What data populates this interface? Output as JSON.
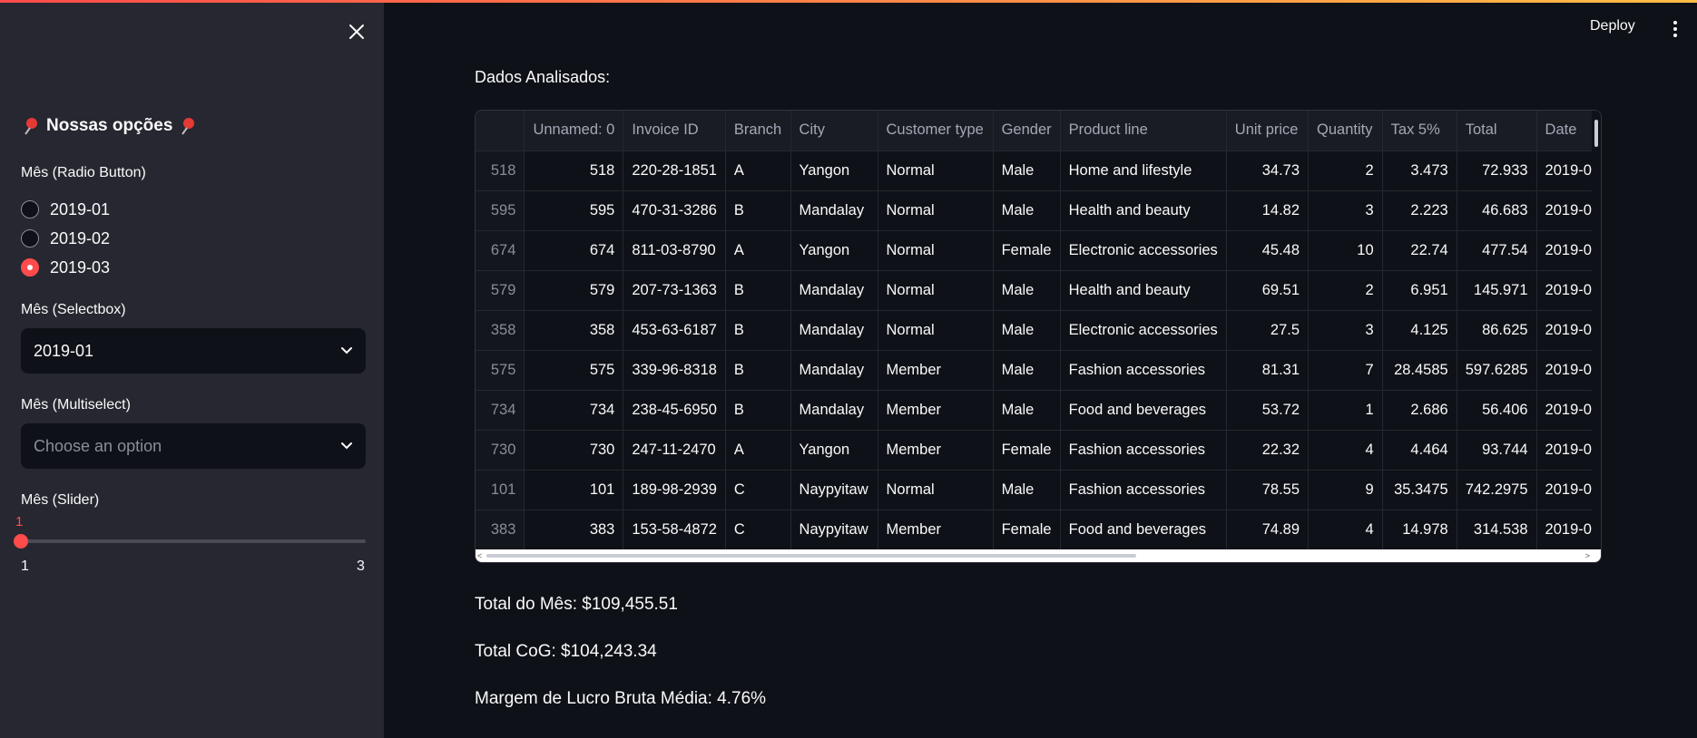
{
  "sidebar": {
    "heading": "Nossas opções",
    "radio": {
      "label": "Mês (Radio Button)",
      "options": [
        "2019-01",
        "2019-02",
        "2019-03"
      ],
      "selected": "2019-03"
    },
    "selectbox": {
      "label": "Mês (Selectbox)",
      "value": "2019-01"
    },
    "multiselect": {
      "label": "Mês (Multiselect)",
      "placeholder": "Choose an option"
    },
    "slider": {
      "label": "Mês (Slider)",
      "value": "1",
      "min": "1",
      "max": "3"
    }
  },
  "header": {
    "deploy_label": "Deploy"
  },
  "main": {
    "section_title": "Dados Analisados:",
    "table": {
      "columns": [
        "",
        "Unnamed: 0",
        "Invoice ID",
        "Branch",
        "City",
        "Customer type",
        "Gender",
        "Product line",
        "Unit price",
        "Quantity",
        "Tax 5%",
        "Total",
        "Date"
      ],
      "rows": [
        [
          "518",
          "518",
          "220-28-1851",
          "A",
          "Yangon",
          "Normal",
          "Male",
          "Home and lifestyle",
          "34.73",
          "2",
          "3.473",
          "72.933",
          "2019-0"
        ],
        [
          "595",
          "595",
          "470-31-3286",
          "B",
          "Mandalay",
          "Normal",
          "Male",
          "Health and beauty",
          "14.82",
          "3",
          "2.223",
          "46.683",
          "2019-0"
        ],
        [
          "674",
          "674",
          "811-03-8790",
          "A",
          "Yangon",
          "Normal",
          "Female",
          "Electronic accessories",
          "45.48",
          "10",
          "22.74",
          "477.54",
          "2019-0"
        ],
        [
          "579",
          "579",
          "207-73-1363",
          "B",
          "Mandalay",
          "Normal",
          "Male",
          "Health and beauty",
          "69.51",
          "2",
          "6.951",
          "145.971",
          "2019-0"
        ],
        [
          "358",
          "358",
          "453-63-6187",
          "B",
          "Mandalay",
          "Normal",
          "Male",
          "Electronic accessories",
          "27.5",
          "3",
          "4.125",
          "86.625",
          "2019-0"
        ],
        [
          "575",
          "575",
          "339-96-8318",
          "B",
          "Mandalay",
          "Member",
          "Male",
          "Fashion accessories",
          "81.31",
          "7",
          "28.4585",
          "597.6285",
          "2019-0"
        ],
        [
          "734",
          "734",
          "238-45-6950",
          "B",
          "Mandalay",
          "Member",
          "Male",
          "Food and beverages",
          "53.72",
          "1",
          "2.686",
          "56.406",
          "2019-0"
        ],
        [
          "730",
          "730",
          "247-11-2470",
          "A",
          "Yangon",
          "Member",
          "Female",
          "Fashion accessories",
          "22.32",
          "4",
          "4.464",
          "93.744",
          "2019-0"
        ],
        [
          "101",
          "101",
          "189-98-2939",
          "C",
          "Naypyitaw",
          "Normal",
          "Male",
          "Fashion accessories",
          "78.55",
          "9",
          "35.3475",
          "742.2975",
          "2019-0"
        ],
        [
          "383",
          "383",
          "153-58-4872",
          "C",
          "Naypyitaw",
          "Member",
          "Female",
          "Food and beverages",
          "74.89",
          "4",
          "14.978",
          "314.538",
          "2019-0"
        ]
      ]
    },
    "metrics": [
      "Total do Mês: $109,455.51",
      "Total CoG: $104,243.34",
      "Margem de Lucro Bruta Média: 4.76%"
    ]
  },
  "colors": {
    "accent": "#ff4b4b",
    "sidebar_bg": "#262730",
    "main_bg": "#0e1117"
  },
  "icons": {
    "close": "close-icon",
    "pin": "pushpin-icon",
    "chevron": "chevron-down-icon",
    "menu": "kebab-menu-icon"
  }
}
